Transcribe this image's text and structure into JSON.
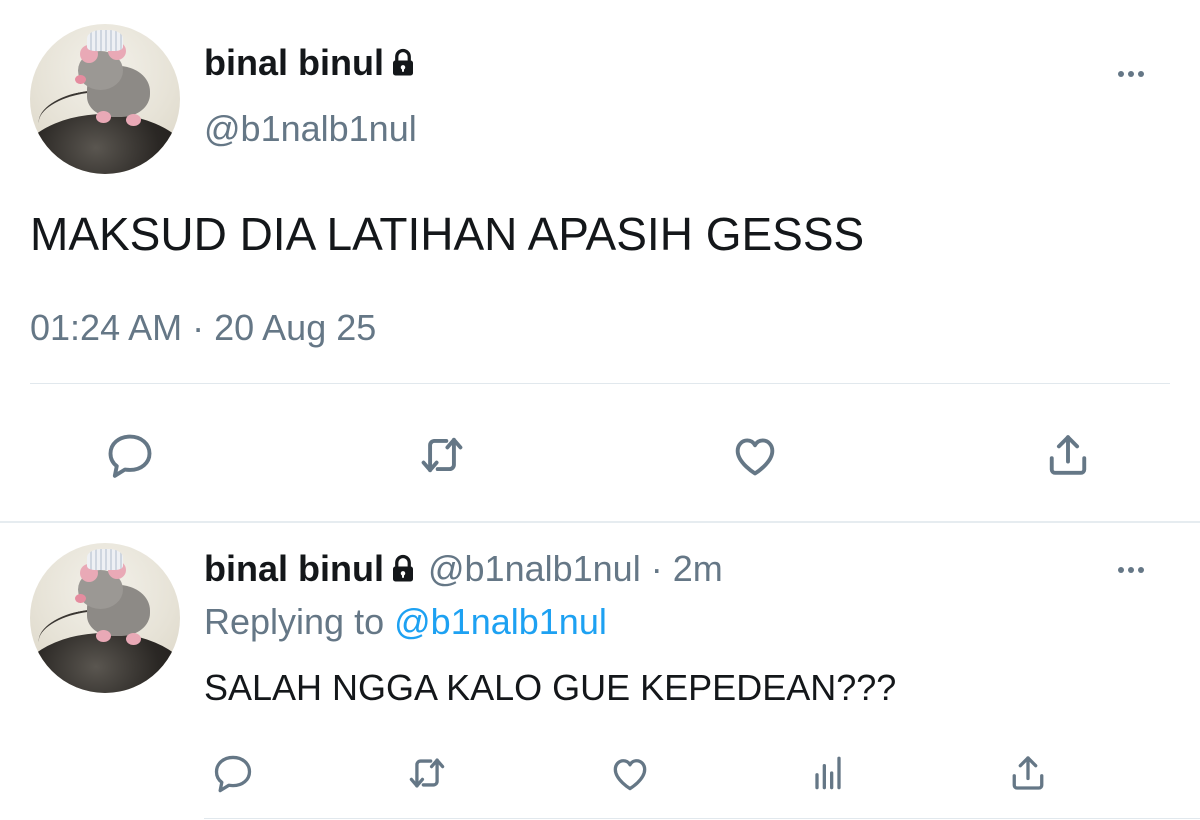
{
  "main_tweet": {
    "display_name": "binal binul",
    "handle": "@b1nalb1nul",
    "text": "MAKSUD DIA LATIHAN APASIH GESSS",
    "timestamp": "01:24 AM · 20 Aug 25",
    "icons": [
      "lock-icon",
      "more-icon",
      "reply-icon",
      "retweet-icon",
      "like-icon",
      "share-icon"
    ]
  },
  "reply_tweet": {
    "display_name": "binal binul",
    "handle": "@b1nalb1nul",
    "separator": "·",
    "age": "2m",
    "replying_prefix": "Replying to",
    "replying_handle": "@b1nalb1nul",
    "text": "SALAH NGGA KALO GUE KEPEDEAN???",
    "icons": [
      "lock-icon",
      "more-icon",
      "reply-icon",
      "retweet-icon",
      "like-icon",
      "analytics-icon",
      "share-icon"
    ]
  },
  "colors": {
    "text": "#14171a",
    "secondary": "#657786",
    "link": "#1da1f2",
    "divider": "#e1e8ed"
  }
}
